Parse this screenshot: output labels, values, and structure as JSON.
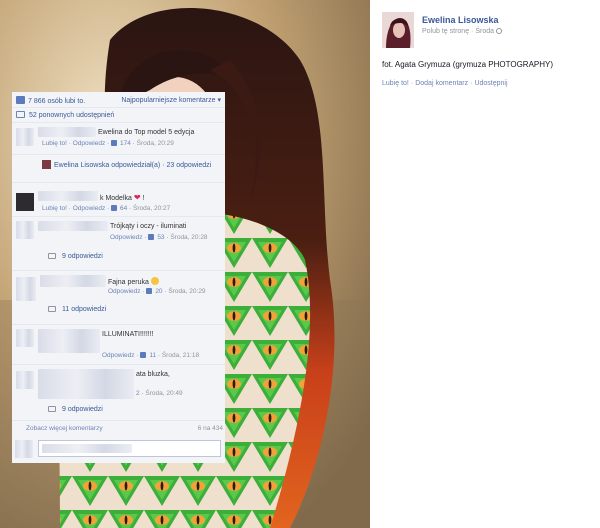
{
  "author": {
    "name": "Ewelina Lisowska",
    "like_page": "Polub tę stronę",
    "date": "Środa"
  },
  "caption": "fot. Agata Grymuza (grymuza PHOTOGRAPHY)",
  "actions": {
    "like": "Lubię to!",
    "comment": "Dodaj komentarz",
    "share": "Udostępnij"
  },
  "likes": {
    "count_text": "7 866 osób lubi to.",
    "sort": "Najpopularniejsze komentarze"
  },
  "shares_text": "52 ponownych udostępnień",
  "comments": [
    {
      "text": "Ewelina do Top model 5 edycja",
      "meta_links": "Lubię to! · Odpowiedz",
      "likes": "174",
      "time": "Środa, 20:29"
    },
    {
      "reply_author": "Ewelina Lisowska odpowiedział(a)",
      "reply_count": "23 odpowiedzi"
    },
    {
      "text": "k Modelka",
      "emoji": "❤",
      "suffix": "!",
      "meta_links": "Lubię to! · Odpowiedz",
      "likes": "64",
      "time": "Środa, 20:27"
    },
    {
      "text": "Trójkąty i oczy - iluminati",
      "meta_links": "Odpowiedz",
      "likes": "53",
      "time": "Środa, 20:28",
      "replies": "9 odpowiedzi"
    },
    {
      "text": "Fajna peruka",
      "meta_links": "Odpowiedz",
      "likes": "20",
      "time": "Środa, 20:29",
      "replies": "11 odpowiedzi"
    },
    {
      "text": "ILLUMINATI!!!!!!!",
      "meta_links": "Odpowiedz",
      "likes": "11",
      "time": "Środa, 21:18"
    },
    {
      "text": "ata bluzka,",
      "likes": "2",
      "time": "Środa, 20:49",
      "replies": "9 odpowiedzi"
    }
  ],
  "more": {
    "label": "Zobacz więcej komentarzy",
    "count": "6 na 434"
  }
}
